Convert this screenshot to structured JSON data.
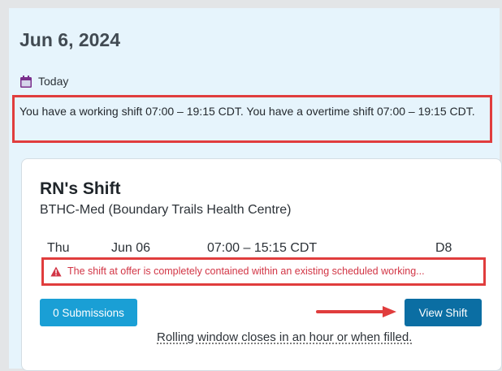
{
  "header": {
    "date": "Jun 6, 2024"
  },
  "today": {
    "label": "Today",
    "icon": "calendar-icon"
  },
  "notice": {
    "text": "You have a working shift 07:00 – 19:15 CDT. You have a overtime shift 07:00 – 19:15 CDT."
  },
  "shift_card": {
    "title": "RN's Shift",
    "location": "BTHC-Med (Boundary Trails Health Centre)",
    "day": "Thu",
    "date": "Jun 06",
    "time": "07:00 – 15:15 CDT",
    "code": "D8",
    "warning": {
      "icon": "warning-icon",
      "text": "The shift at offer is completely contained within an existing scheduled working..."
    },
    "submissions_label": "0 Submissions",
    "view_label": "View Shift",
    "rolling_text": "Rolling window closes in an hour or when filled."
  },
  "colors": {
    "page_background": "#e6f4fc",
    "highlight_border": "#e03d3d",
    "submissions_button": "#1a9fd5",
    "view_button": "#0b6ea3",
    "warning_text": "#d23545",
    "calendar_icon": "#7a2f8c"
  }
}
